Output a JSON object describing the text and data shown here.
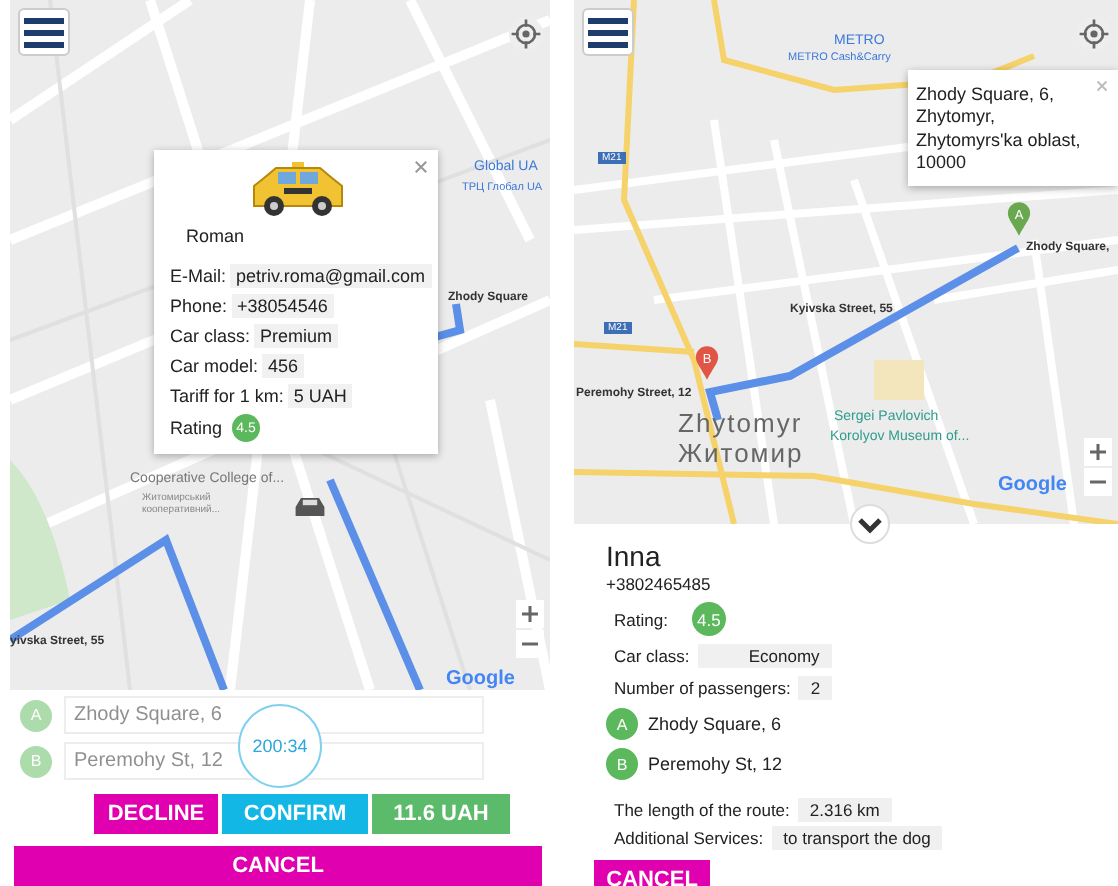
{
  "driver_screen": {
    "map": {
      "labels": [
        {
          "text": "Global UA",
          "kind": "poi"
        },
        {
          "text": "ТРЦ Глобал UA",
          "kind": "poi_sub"
        },
        {
          "text": "Zhody Square",
          "kind": "stop"
        },
        {
          "text": "Cooperative College of...",
          "kind": "place"
        },
        {
          "text": "Житомирський",
          "kind": "tiny"
        },
        {
          "text": "кооперативний...",
          "kind": "tiny"
        },
        {
          "text": "yivska Street, 55",
          "kind": "stop_cut"
        },
        {
          "text": "Google",
          "kind": "google"
        }
      ]
    },
    "driver_popup": {
      "name": "Roman",
      "fields": [
        {
          "label": "E-Mail:",
          "value": "petriv.roma@gmail.com"
        },
        {
          "label": "Phone:",
          "value": "+38054546"
        },
        {
          "label": "Car class:",
          "value": "Premium"
        },
        {
          "label": "Car model:",
          "value": "456"
        },
        {
          "label": "Tariff for 1 km:",
          "value": "5 UAH"
        }
      ],
      "rating_label": "Rating",
      "rating": "4.5"
    },
    "waypoints": [
      {
        "letter": "A",
        "address": "Zhody Square, 6",
        "disabled": true
      },
      {
        "letter": "B",
        "address": "Peremohy St, 12",
        "disabled": true
      }
    ],
    "timer": "200:34",
    "buttons": [
      {
        "label": "DECLINE",
        "kind": "decline"
      },
      {
        "label": "CONFIRM",
        "kind": "confirm"
      },
      {
        "label": "11.6 UAH",
        "kind": "price"
      }
    ],
    "cancel": "CANCEL"
  },
  "passenger_screen": {
    "map": {
      "labels": [
        {
          "text": "METRO",
          "kind": "poi"
        },
        {
          "text": "METRO Cash&Carry",
          "kind": "poi_sub"
        },
        {
          "text": "M21",
          "kind": "shield"
        },
        {
          "text": "M21",
          "kind": "shield"
        },
        {
          "text": "Zhody Square,",
          "kind": "stop"
        },
        {
          "text": "Kyivska Street, 55",
          "kind": "stop"
        },
        {
          "text": "Peremohy Street, 12",
          "kind": "stop"
        },
        {
          "text": "Zhytomyr",
          "kind": "city"
        },
        {
          "text": "Житомир",
          "kind": "city"
        },
        {
          "text": "Sergei Pavlovich",
          "kind": "museum"
        },
        {
          "text": "Korolyov Museum of...",
          "kind": "museum"
        },
        {
          "text": "Google",
          "kind": "google"
        }
      ],
      "pins": [
        {
          "letter": "A",
          "color": "#6aa84f"
        },
        {
          "letter": "B",
          "color": "#e05545"
        }
      ],
      "address_popup": "Zhody Square, 6, Zhytomyr, Zhytomyrs'ka oblast, 10000"
    },
    "passenger": {
      "name": "Inna",
      "phone": "+3802465485",
      "rating_label": "Rating:",
      "rating": "4.5",
      "fields": [
        {
          "label": "Car class:",
          "value": "Economy"
        },
        {
          "label": "Number of passengers:",
          "value": "2"
        }
      ],
      "waypoints": [
        {
          "letter": "A",
          "address": "Zhody Square, 6",
          "disabled": false
        },
        {
          "letter": "B",
          "address": "Peremohy St, 12",
          "disabled": false
        }
      ],
      "route_fields": [
        {
          "label": "The length of the route:",
          "value": "2.316 km"
        },
        {
          "label": "Additional Services:",
          "value": "to transport the dog"
        }
      ]
    },
    "cancel": "CANCEL"
  }
}
